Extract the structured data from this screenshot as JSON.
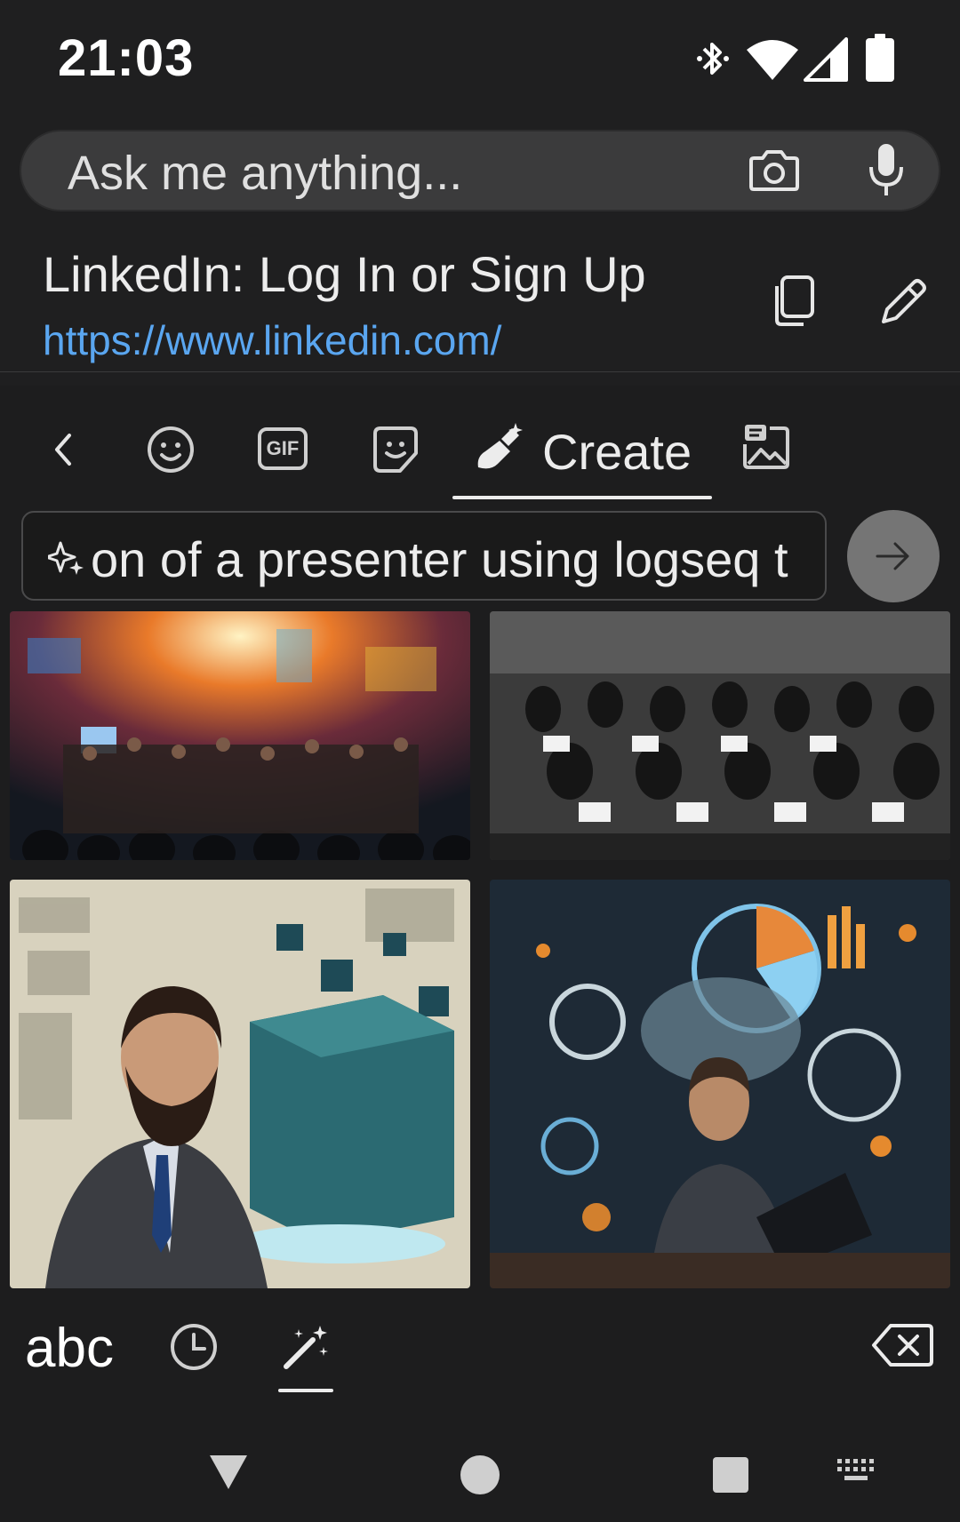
{
  "status_bar": {
    "time": "21:03",
    "icons": [
      "bluetooth-icon",
      "wifi-icon",
      "cell-signal-icon",
      "battery-icon"
    ]
  },
  "search": {
    "placeholder": "Ask me anything...",
    "icons": [
      "camera-icon",
      "mic-icon"
    ]
  },
  "suggestion": {
    "title": "LinkedIn: Log In or Sign Up",
    "url": "https://www.linkedin.com/",
    "actions": [
      "copy-icon",
      "edit-pencil-icon"
    ]
  },
  "keyboard": {
    "tabs": {
      "back": "chevron-left-icon",
      "emoji": "emoji-icon",
      "gif": "GIF",
      "sticker": "sticker-icon",
      "create": "Create",
      "image": "image-gallery-icon"
    },
    "active_tab": "Create",
    "prompt": {
      "text": "on of a presenter using logseq t",
      "icon": "sparkle-icon"
    },
    "send_icon": "arrow-right-icon",
    "images": [
      "generated-image-crowd-colorful",
      "generated-image-classroom-laptops",
      "generated-image-bearded-presenter-cube",
      "generated-image-man-laptop-gears"
    ],
    "bottom": {
      "abc_label": "abc",
      "history_icon": "clock-icon",
      "wand_icon": "magic-wand-icon",
      "backspace_icon": "backspace-icon"
    },
    "colors": {
      "background": "#1d1d1e",
      "accent_link": "#5aa6f0",
      "send_button": "#757575"
    }
  },
  "nav_bar": [
    "back-triangle-icon",
    "home-circle-icon",
    "recents-square-icon",
    "keyboard-switch-icon"
  ]
}
